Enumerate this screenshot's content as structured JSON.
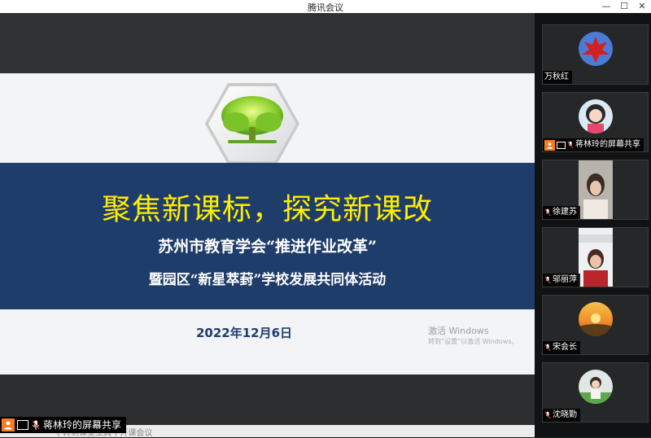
{
  "window": {
    "title": "腾讯会议",
    "controls": {
      "minimize": "—",
      "maximize": "☐",
      "close": "✕"
    }
  },
  "slide": {
    "headline": "聚焦新课标，探究新课改",
    "subtitle1": "苏州市教育学会“推进作业改革”",
    "subtitle2": "暨园区“新星萃葑”学校发展共同体活动",
    "date": "2022年12月6日",
    "watermark_line1": "激活 Windows",
    "watermark_line2": "转到“设置”以激活 Windows。"
  },
  "taskstrip": {
    "faded_text": "( 转到课堂工具 ) 开课会议"
  },
  "share_label": {
    "text": "蒋林玲的屏幕共享"
  },
  "participants": [
    {
      "name": "万秋红",
      "type": "avatar",
      "avatar_icon": "red-leaf-icon"
    },
    {
      "name": "蒋林玲的屏幕共享",
      "type": "avatar",
      "avatar_icon": "cartoon-girl-icon",
      "sharing": true
    },
    {
      "name": "徐建苏",
      "type": "video"
    },
    {
      "name": "邬丽萍",
      "type": "video"
    },
    {
      "name": "宋会长",
      "type": "avatar",
      "avatar_icon": "sunset-icon"
    },
    {
      "name": "沈晓勤",
      "type": "avatar",
      "avatar_icon": "child-photo-icon"
    }
  ],
  "colors": {
    "banner": "#1f3d6b",
    "headline": "#ffee00",
    "accent_orange": "#f57c22"
  }
}
